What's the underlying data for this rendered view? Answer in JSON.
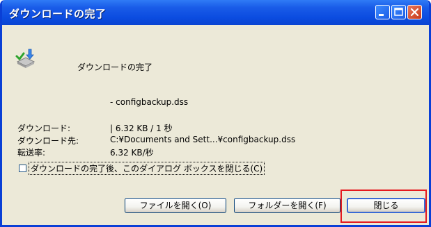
{
  "window": {
    "title": "ダウンロードの完了"
  },
  "header": {
    "text": "ダウンロードの完了",
    "icon": "download-complete-icon"
  },
  "file": {
    "name": "- configbackup.dss"
  },
  "info": {
    "download_label": "ダウンロード:",
    "download_value": "| 6.32 KB / 1 秒",
    "dest_label": "ダウンロード先:",
    "dest_value": "C:¥Documents and Sett...¥configbackup.dss",
    "rate_label": "転送率:",
    "rate_value": "6.32 KB/秒"
  },
  "checkbox": {
    "label": "ダウンロードの完了後、このダイアログ ボックスを閉じる(C)",
    "checked": false
  },
  "buttons": {
    "open_file": "ファイルを開く(O)",
    "open_folder": "フォルダーを開く(F)",
    "close": "閉じる"
  },
  "colors": {
    "titlebar": "#0A44D2",
    "highlight": "#E5191F"
  }
}
